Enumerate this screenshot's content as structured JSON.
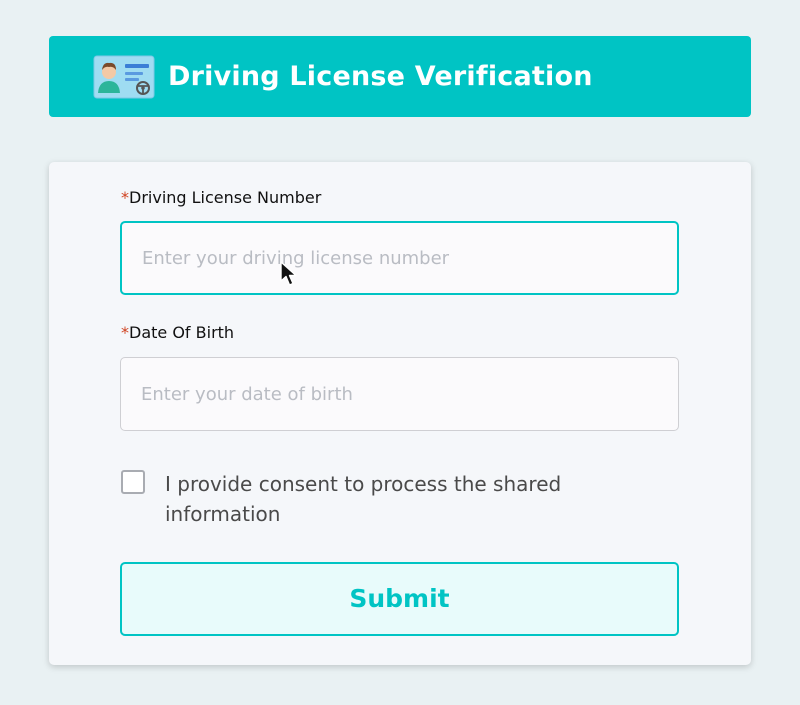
{
  "header": {
    "icon": "driving-license-card-icon",
    "title": "Driving License Verification",
    "bg_color": "#00c4c4"
  },
  "form": {
    "license_field": {
      "required_marker": "*",
      "label": "Driving License Number",
      "placeholder": "Enter your driving license number",
      "value": ""
    },
    "dob_field": {
      "required_marker": "*",
      "label": "Date Of Birth",
      "placeholder": "Enter your date of birth",
      "value": ""
    },
    "consent": {
      "checked": false,
      "text": "I provide consent to process the shared information"
    },
    "submit_label": "Submit"
  },
  "colors": {
    "accent": "#00c4c4",
    "required": "#d0411f",
    "page_bg": "#e9f1f3"
  },
  "cursor_icon": "arrow-pointer-icon"
}
